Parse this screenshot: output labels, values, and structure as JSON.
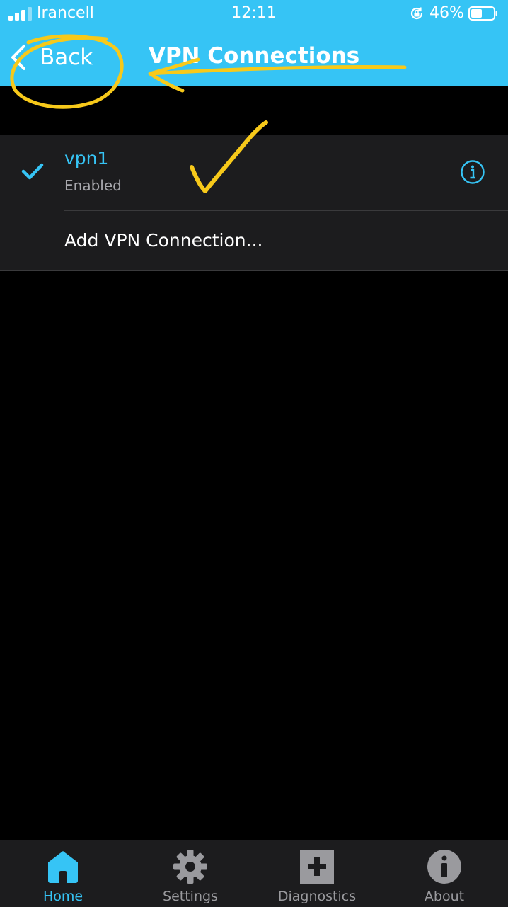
{
  "status_bar": {
    "carrier": "Irancell",
    "time": "12:11",
    "battery_percent": "46%"
  },
  "nav": {
    "back_label": "Back",
    "title": "VPN Connections"
  },
  "vpn_list": {
    "items": [
      {
        "name": "vpn1",
        "status": "Enabled",
        "selected": true
      }
    ],
    "add_label": "Add VPN Connection..."
  },
  "tab_bar": {
    "tabs": [
      {
        "label": "Home",
        "icon": "home-icon",
        "active": true
      },
      {
        "label": "Settings",
        "icon": "gear-icon",
        "active": false
      },
      {
        "label": "Diagnostics",
        "icon": "plus-box-icon",
        "active": false
      },
      {
        "label": "About",
        "icon": "info-circle-icon",
        "active": false
      }
    ]
  },
  "colors": {
    "accent": "#36c4f5",
    "background": "#000000",
    "list_background": "#1c1c1e",
    "inactive_tab": "#9a9a9e",
    "annotation": "#f7c91a"
  }
}
